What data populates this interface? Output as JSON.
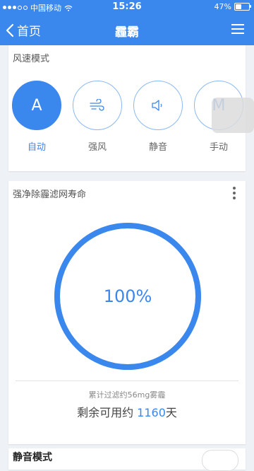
{
  "status_bar": {
    "carrier": "中国移动",
    "time": "15:26",
    "battery": "47%",
    "battery_level": 0.47
  },
  "nav": {
    "back_label": "首页",
    "title": "霾霸"
  },
  "wind_mode": {
    "title": "风速模式",
    "modes": [
      {
        "letter": "A",
        "label": "自动",
        "icon": "auto-letter",
        "active": true
      },
      {
        "label": "强风",
        "icon": "wind-icon",
        "active": false
      },
      {
        "label": "静音",
        "icon": "speaker-icon",
        "active": false
      },
      {
        "letter": "M",
        "label": "手动",
        "icon": "manual-letter",
        "active": false
      }
    ]
  },
  "filter": {
    "title": "强净除霾滤网寿命",
    "percent_text": "100%",
    "percent_value": 1.0,
    "filtered_text": "累计过滤约56mg雾霾",
    "remaining_prefix": "剩余可用约 ",
    "remaining_days": "1160",
    "remaining_suffix": "天"
  },
  "next_section": {
    "title": "静音模式"
  },
  "colors": {
    "accent": "#3a87ee",
    "background": "#eef1f5"
  }
}
